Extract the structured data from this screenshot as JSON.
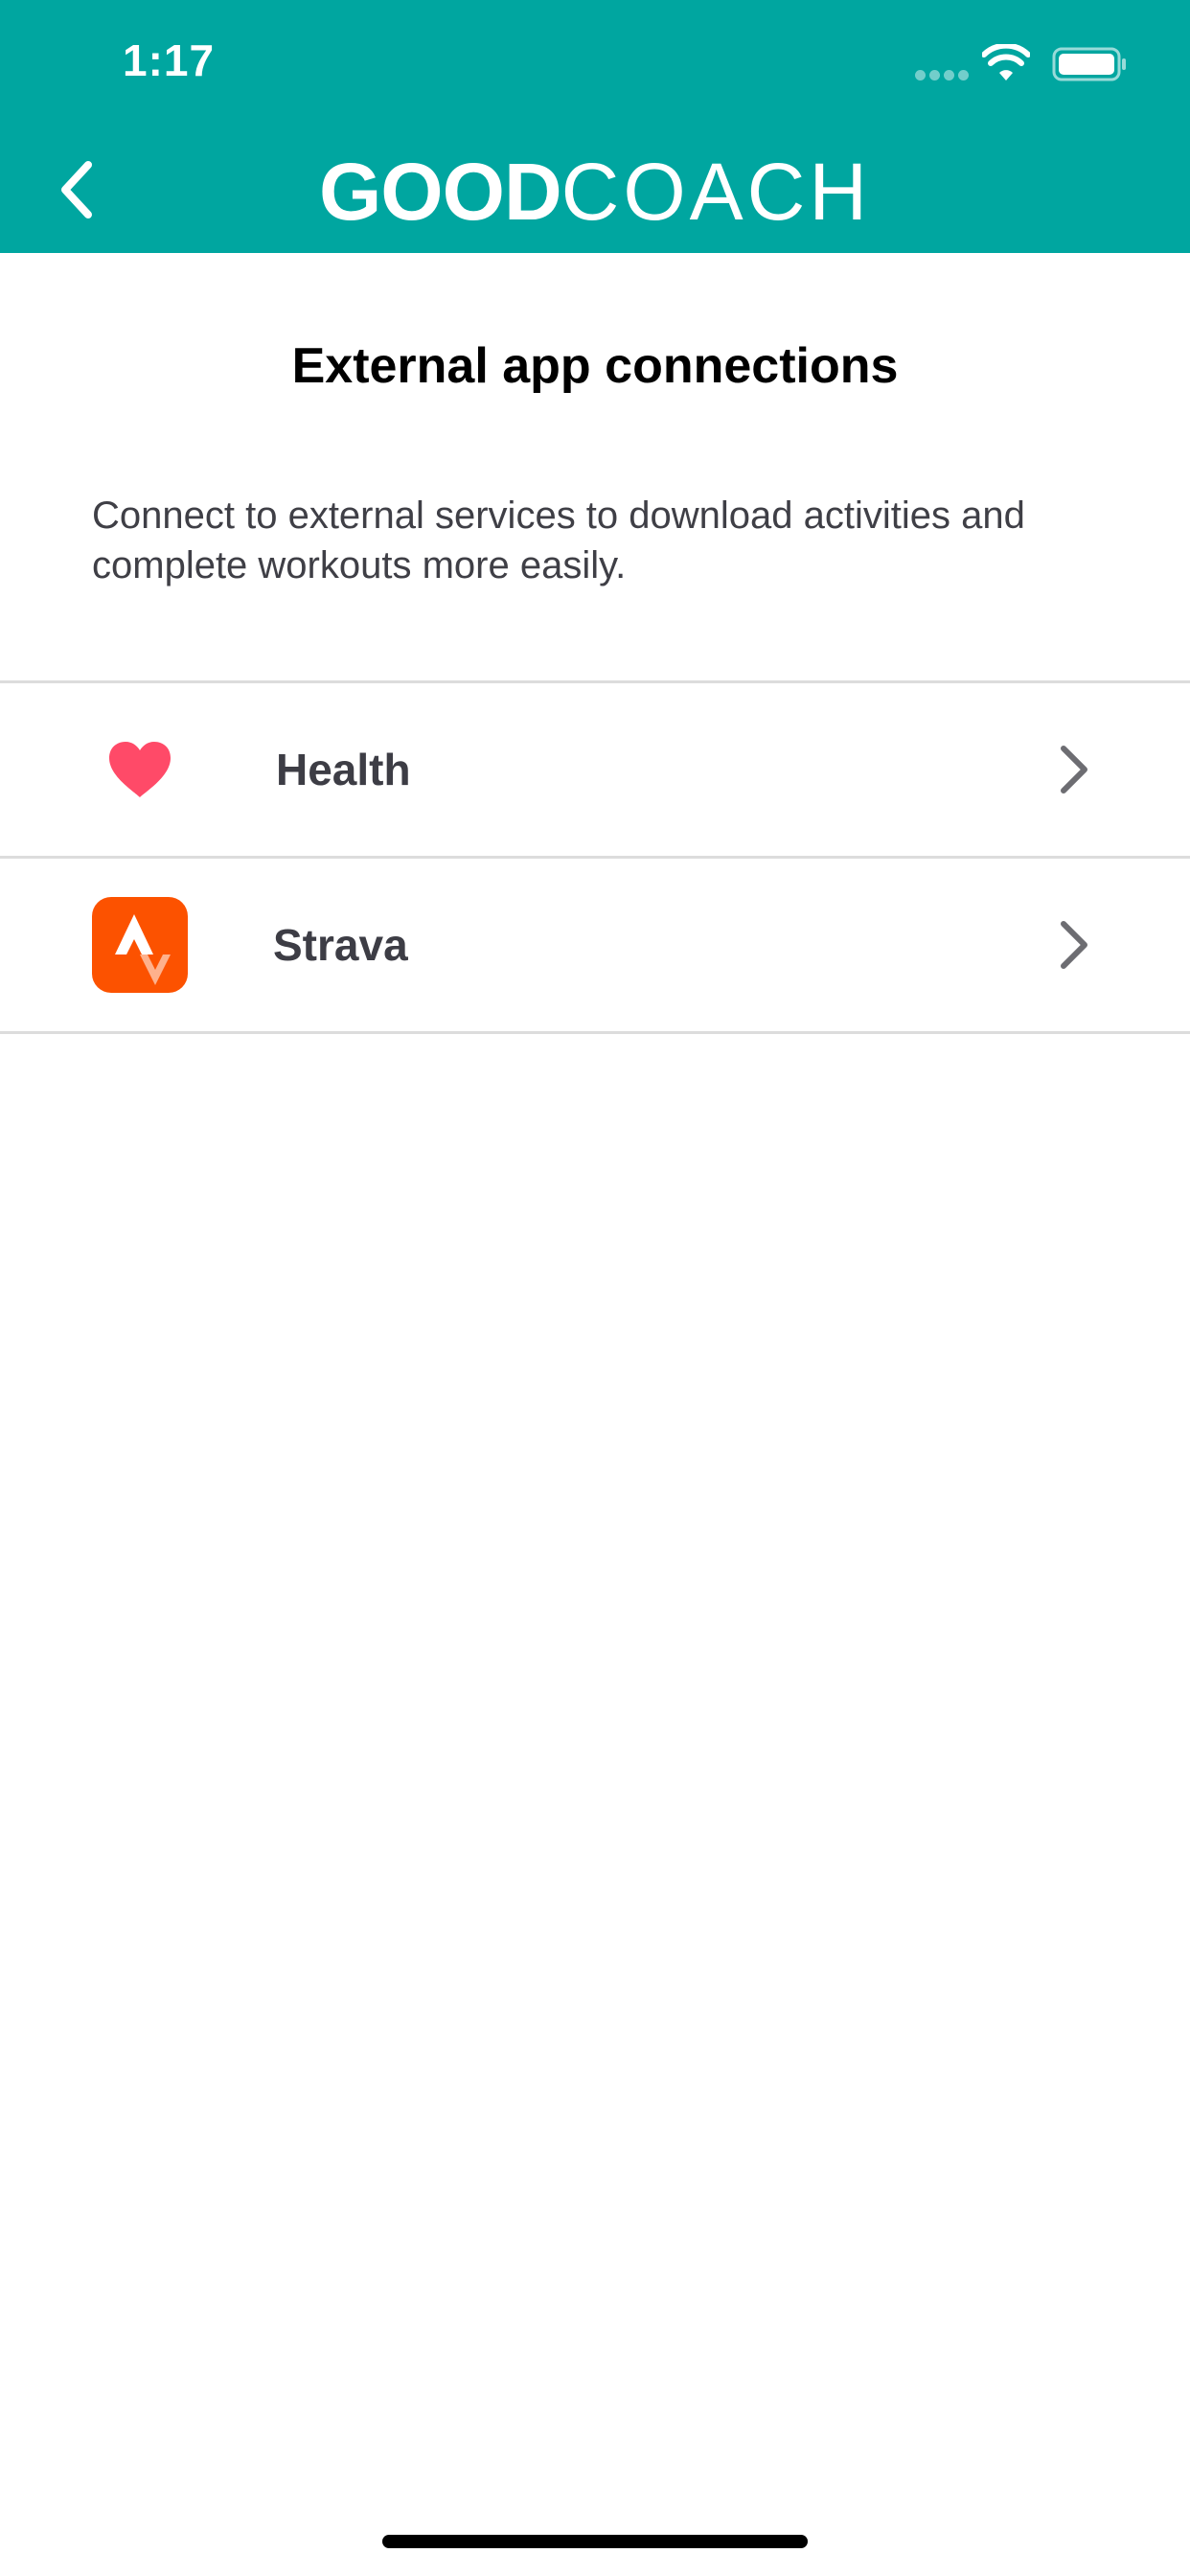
{
  "status_bar": {
    "time": "1:17"
  },
  "header": {
    "brand_bold": "GOOD",
    "brand_light": "COACH",
    "background_color": "#00A6A0"
  },
  "page": {
    "title": "External app connections",
    "description": "Connect to external services to download activities and complete workouts more easily."
  },
  "connections": [
    {
      "label": "Health",
      "icon": "heart-icon",
      "icon_color": "#FF4A68"
    },
    {
      "label": "Strava",
      "icon": "strava-icon",
      "icon_color": "#FC5200"
    }
  ]
}
